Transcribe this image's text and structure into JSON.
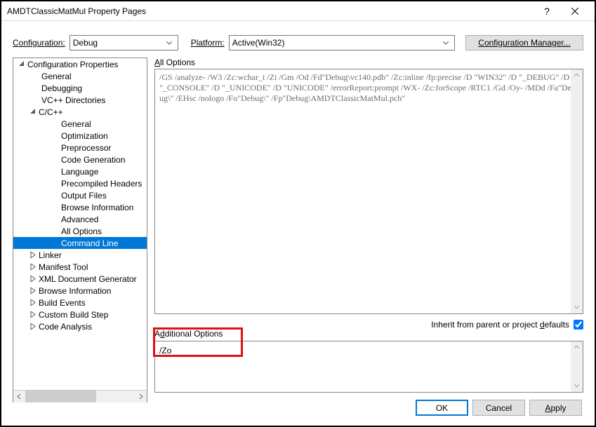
{
  "window": {
    "title": "AMDTClassicMatMul Property Pages"
  },
  "toolbar": {
    "config_label": "Configuration:",
    "config_value": "Debug",
    "platform_label": "Platform:",
    "platform_value": "Active(Win32)",
    "config_mgr": "Configuration Manager..."
  },
  "tree": {
    "root": "Configuration Properties",
    "items": [
      "General",
      "Debugging",
      "VC++ Directories"
    ],
    "cpp": {
      "label": "C/C++",
      "items": [
        "General",
        "Optimization",
        "Preprocessor",
        "Code Generation",
        "Language",
        "Precompiled Headers",
        "Output Files",
        "Browse Information",
        "Advanced",
        "All Options",
        "Command Line"
      ]
    },
    "tail": [
      "Linker",
      "Manifest Tool",
      "XML Document Generator",
      "Browse Information",
      "Build Events",
      "Custom Build Step",
      "Code Analysis"
    ]
  },
  "right": {
    "all_opts_label": "All Options",
    "all_opts_text": "/GS /analyze- /W3 /Zc:wchar_t /Zi /Gm /Od /Fd\"Debug\\vc140.pdb\" /Zc:inline /fp:precise /D \"WIN32\" /D \"_DEBUG\" /D \"_CONSOLE\" /D \"_UNICODE\" /D \"UNICODE\" /errorReport:prompt /WX- /Zc:forScope /RTC1 /Gd /Oy- /MDd /Fa\"Debug\\\" /EHsc /nologo /Fo\"Debug\\\" /Fp\"Debug\\AMDTClassicMatMul.pch\"",
    "inherit_label": "Inherit from parent or project defaults",
    "addl_label": "Additional Options",
    "addl_text": "/Zo"
  },
  "footer": {
    "ok": "OK",
    "cancel": "Cancel",
    "apply": "Apply"
  }
}
